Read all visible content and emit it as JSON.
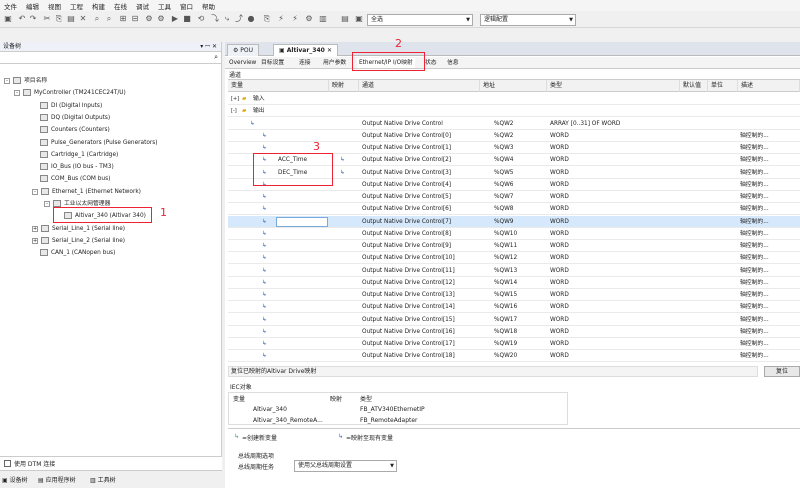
{
  "menu": [
    "文件",
    "编辑",
    "视图",
    "工程",
    "构建",
    "在线",
    "调试",
    "工具",
    "窗口",
    "帮助"
  ],
  "toolbar": {
    "device_select": "全选",
    "mode_select": "逻辑配置"
  },
  "left_panel": {
    "title": "设备树",
    "pin": "▾ ꟷ ✕"
  },
  "tree": [
    {
      "label": "项目名称",
      "indent": 0,
      "exp": "-"
    },
    {
      "label": "MyController (TM241CEC24T/U)",
      "indent": 1,
      "exp": "-"
    },
    {
      "label": "DI (Digital Inputs)",
      "indent": 2
    },
    {
      "label": "DQ (Digital Outputs)",
      "indent": 2
    },
    {
      "label": "Counters (Counters)",
      "indent": 2
    },
    {
      "label": "Pulse_Generators (Pulse Generators)",
      "indent": 2
    },
    {
      "label": "Cartridge_1 (Cartridge)",
      "indent": 2
    },
    {
      "label": "IO_Bus (IO bus - TM3)",
      "indent": 2
    },
    {
      "label": "COM_Bus (COM bus)",
      "indent": 2
    },
    {
      "label": "Ethernet_1 (Ethernet Network)",
      "indent": 2,
      "exp": "-"
    },
    {
      "label": "工业以太网管理器",
      "indent": 3,
      "exp": "-"
    },
    {
      "label": "Altivar_340 (Altivar 340)",
      "indent": 4
    },
    {
      "label": "Serial_Line_1 (Serial line)",
      "indent": 2,
      "exp": "+"
    },
    {
      "label": "Serial_Line_2 (Serial line)",
      "indent": 2,
      "exp": "+"
    },
    {
      "label": "CAN_1 (CANopen bus)",
      "indent": 2
    }
  ],
  "annotations": {
    "n1": "1",
    "n2": "2",
    "n3": "3"
  },
  "dtm_checkbox": "使用 DTM 连接",
  "bottom_tabs": [
    "设备树",
    "应用程序树",
    "工具树"
  ],
  "doc_tabs": [
    "POU",
    "Altivar_340"
  ],
  "sub_tabs": [
    "Overview",
    "目标设置",
    "连接",
    "用户参数",
    "Ethernet/IP I/O映射",
    "状态",
    "信息"
  ],
  "channels_label": "通道",
  "grid": {
    "headers": [
      "变量",
      "映射",
      "通道",
      "地址",
      "类型",
      "默认值",
      "单位",
      "描述"
    ],
    "rows": [
      {
        "var": "输入",
        "exp": "+",
        "folder": true
      },
      {
        "var": "输出",
        "exp": "-",
        "folder": true
      },
      {
        "var": "",
        "channel": "Output Native Drive Control",
        "addr": "%QW2",
        "type": "ARRAY [0..31] OF WORD",
        "desc": ""
      },
      {
        "var": "",
        "channel": "Output Native Drive Control[0]",
        "addr": "%QW2",
        "type": "WORD",
        "desc": "轴控制的..."
      },
      {
        "var": "",
        "channel": "Output Native Drive Control[1]",
        "addr": "%QW3",
        "type": "WORD",
        "desc": "轴控制的..."
      },
      {
        "var": "ACC_Time",
        "map": true,
        "channel": "Output Native Drive Control[2]",
        "addr": "%QW4",
        "type": "WORD",
        "desc": "轴控制的..."
      },
      {
        "var": "DEC_Time",
        "map": true,
        "channel": "Output Native Drive Control[3]",
        "addr": "%QW5",
        "type": "WORD",
        "desc": "轴控制的..."
      },
      {
        "var": "",
        "channel": "Output Native Drive Control[4]",
        "addr": "%QW6",
        "type": "WORD",
        "desc": "轴控制的..."
      },
      {
        "var": "",
        "channel": "Output Native Drive Control[5]",
        "addr": "%QW7",
        "type": "WORD",
        "desc": "轴控制的..."
      },
      {
        "var": "",
        "channel": "Output Native Drive Control[6]",
        "addr": "%QW8",
        "type": "WORD",
        "desc": "轴控制的..."
      },
      {
        "var": "",
        "channel": "Output Native Drive Control[7]",
        "addr": "%QW9",
        "type": "WORD",
        "desc": "轴控制的...",
        "selected": true
      },
      {
        "var": "",
        "channel": "Output Native Drive Control[8]",
        "addr": "%QW10",
        "type": "WORD",
        "desc": "轴控制的..."
      },
      {
        "var": "",
        "channel": "Output Native Drive Control[9]",
        "addr": "%QW11",
        "type": "WORD",
        "desc": "轴控制的..."
      },
      {
        "var": "",
        "channel": "Output Native Drive Control[10]",
        "addr": "%QW12",
        "type": "WORD",
        "desc": "轴控制的..."
      },
      {
        "var": "",
        "channel": "Output Native Drive Control[11]",
        "addr": "%QW13",
        "type": "WORD",
        "desc": "轴控制的..."
      },
      {
        "var": "",
        "channel": "Output Native Drive Control[12]",
        "addr": "%QW14",
        "type": "WORD",
        "desc": "轴控制的..."
      },
      {
        "var": "",
        "channel": "Output Native Drive Control[13]",
        "addr": "%QW15",
        "type": "WORD",
        "desc": "轴控制的..."
      },
      {
        "var": "",
        "channel": "Output Native Drive Control[14]",
        "addr": "%QW16",
        "type": "WORD",
        "desc": "轴控制的..."
      },
      {
        "var": "",
        "channel": "Output Native Drive Control[15]",
        "addr": "%QW17",
        "type": "WORD",
        "desc": "轴控制的..."
      },
      {
        "var": "",
        "channel": "Output Native Drive Control[16]",
        "addr": "%QW18",
        "type": "WORD",
        "desc": "轴控制的..."
      },
      {
        "var": "",
        "channel": "Output Native Drive Control[17]",
        "addr": "%QW19",
        "type": "WORD",
        "desc": "轴控制的..."
      },
      {
        "var": "",
        "channel": "Output Native Drive Control[18]",
        "addr": "%QW20",
        "type": "WORD",
        "desc": "轴控制的..."
      }
    ]
  },
  "reset_label": "复位已映射的Altivar Drive映射",
  "reset_button": "复位",
  "iec": {
    "title": "IEC对象",
    "headers": [
      "变量",
      "映射",
      "类型"
    ],
    "rows": [
      {
        "var": "Altivar_340",
        "type": "FB_ATV340EthernetIP"
      },
      {
        "var": "Altivar_340_RemoteA...",
        "type": "FB_RemoteAdapter"
      }
    ]
  },
  "legend": {
    "new": "=创建新变量",
    "existing": "=映射至现有变量"
  },
  "bus_cycle": {
    "title": "总线周期选项",
    "label": "总线周期任务",
    "value": "使用父总线周期设置"
  }
}
